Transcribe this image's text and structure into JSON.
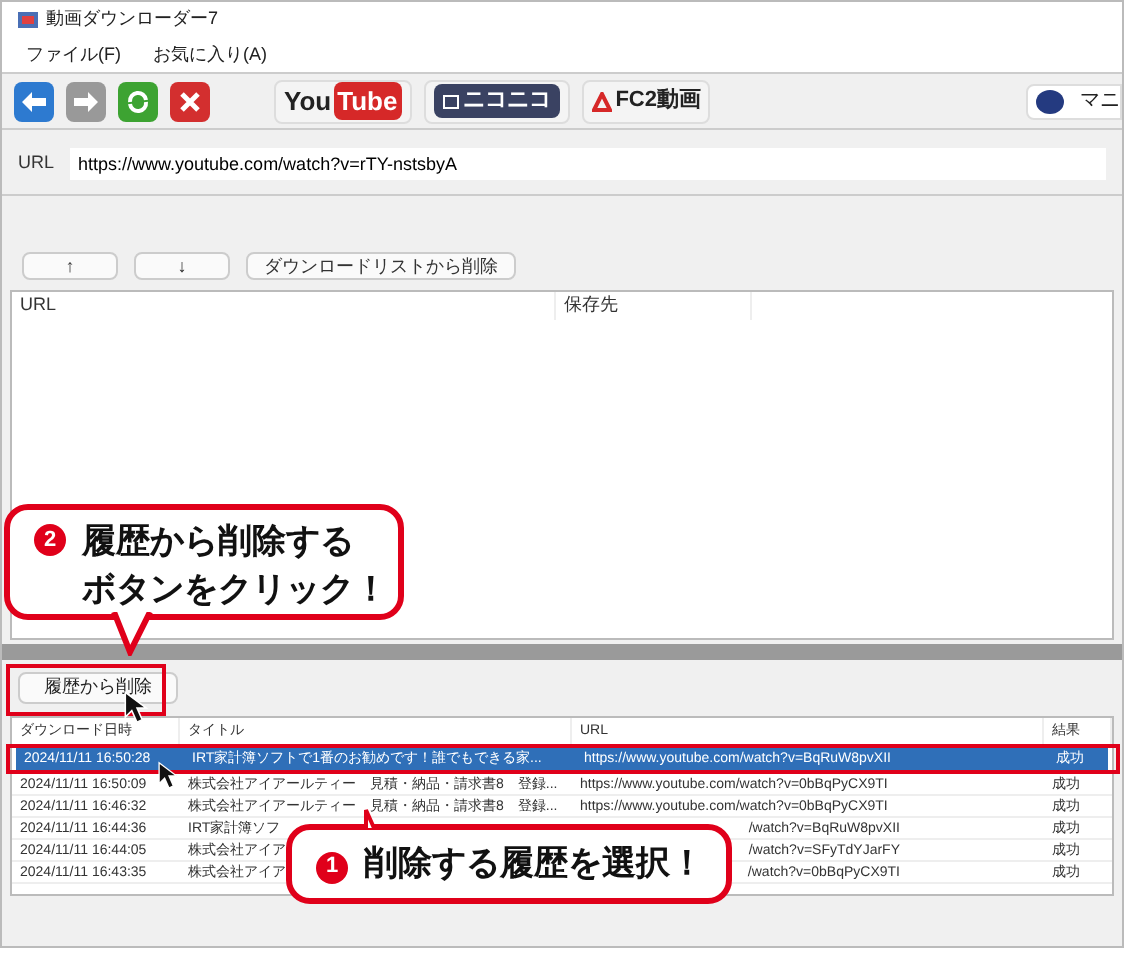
{
  "window": {
    "title": "動画ダウンローダー7"
  },
  "menu": [
    "ファイル(F)",
    "お気に入り(A)"
  ],
  "toolbar": {
    "sites": [
      {
        "kind": "youtube",
        "label_a": "You",
        "label_b": "Tube"
      },
      {
        "kind": "niconico",
        "label_a": "ニコニコ"
      },
      {
        "kind": "fc2",
        "label_a": "FC2動画"
      }
    ],
    "manual": "マニ"
  },
  "url_field": {
    "label": "URL",
    "value": "https://www.youtube.com/watch?v=rTY-nstsbyA"
  },
  "download_list": {
    "buttons": [
      "↑",
      "↓",
      "ダウンロードリストから削除"
    ],
    "columns": [
      "URL",
      "保存先"
    ]
  },
  "history": {
    "button": "履歴から削除",
    "columns": [
      "ダウンロード日時",
      "タイトル",
      "URL",
      "結果"
    ],
    "rows": [
      {
        "selected": true,
        "cells": [
          "2024/11/11 16:50:28",
          "IRT家計簿ソフトで1番のお勧めです！誰でもできる家...",
          "https://www.youtube.com/watch?v=BqRuW8pvXII",
          "成功"
        ]
      },
      {
        "selected": false,
        "cells": [
          "2024/11/11 16:50:09",
          "株式会社アイアールティー　見積・納品・請求書8　登録...",
          "https://www.youtube.com/watch?v=0bBqPyCX9TI",
          "成功"
        ]
      },
      {
        "selected": false,
        "cells": [
          "2024/11/11 16:46:32",
          "株式会社アイアールティー　見積・納品・請求書8　登録...",
          "https://www.youtube.com/watch?v=0bBqPyCX9TI",
          "成功"
        ]
      },
      {
        "selected": false,
        "kind": "partly_covered",
        "cells": [
          "2024/11/11 16:44:36",
          "IRT家計簿ソフ",
          "/watch?v=BqRuW8pvXII",
          "成功"
        ]
      },
      {
        "selected": false,
        "kind": "partly_covered",
        "cells": [
          "2024/11/11 16:44:05",
          "株式会社アイア",
          "/watch?v=SFyTdYJarFY",
          "成功"
        ]
      },
      {
        "selected": false,
        "kind": "partly_covered",
        "cells": [
          "2024/11/11 16:43:35",
          "株式会社アイア",
          "/watch?v=0bBqPyCX9TI",
          "成功"
        ]
      }
    ]
  },
  "callouts": [
    {
      "number": "2",
      "lines": [
        "履歴から削除する",
        "ボタンをクリック！"
      ]
    },
    {
      "number": "1",
      "lines": [
        "削除する履歴を選択！"
      ]
    }
  ]
}
